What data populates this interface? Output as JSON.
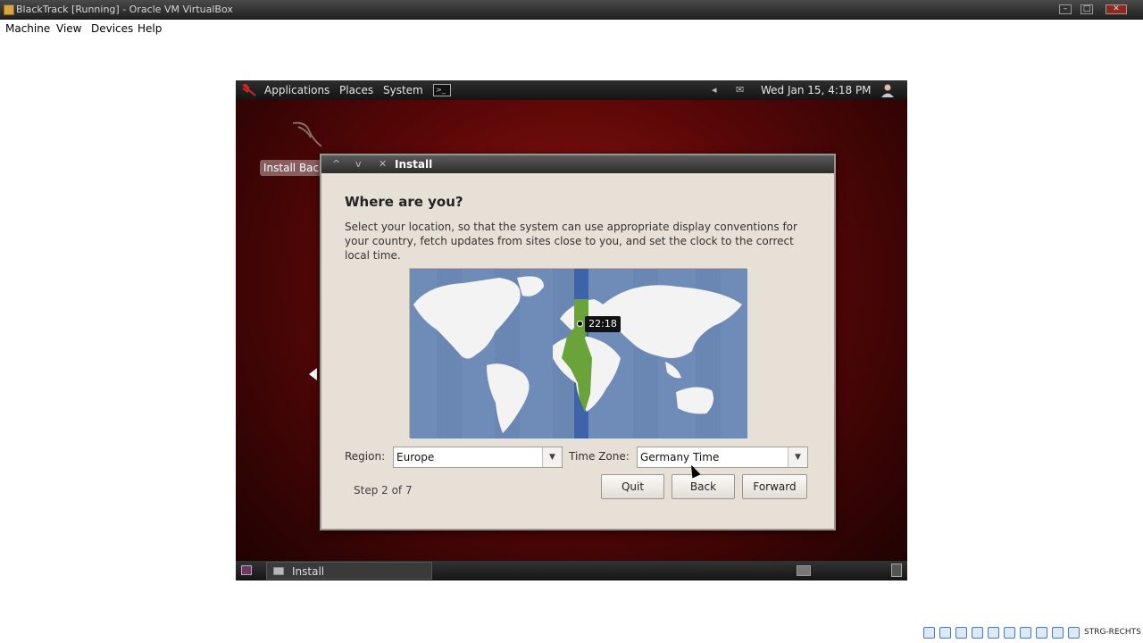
{
  "host": {
    "window_title": "BlackTrack [Running] - Oracle VM VirtualBox",
    "menu": [
      "Machine",
      "View",
      "Devices",
      "Help"
    ],
    "window_controls": [
      "–",
      "□",
      "✕"
    ],
    "status_key": "STRG-RECHTS"
  },
  "guest": {
    "topbar": {
      "menus": [
        "Applications",
        "Places",
        "System"
      ],
      "clock": "Wed Jan 15,  4:18 PM"
    },
    "desktop_icon_label": "Install BackTrack",
    "taskbar": {
      "task_label": "Install"
    }
  },
  "dialog": {
    "title": "Install",
    "title_controls": [
      "^",
      "v",
      "✕"
    ],
    "heading": "Where are you?",
    "description": "Select your location, so that the system can use appropriate display conventions for your country, fetch updates from sites close to you, and set the clock to the correct local time.",
    "map_time": "22:18",
    "region_label": "Region:",
    "region_value": "Europe",
    "timezone_label": "Time Zone:",
    "timezone_value": "Germany Time",
    "step": "Step 2 of 7",
    "buttons": {
      "quit": "Quit",
      "back": "Back",
      "forward": "Forward"
    }
  },
  "colors": {
    "map_ocean": "#6f8cb8",
    "timezone_highlight": "#3f63a8",
    "selected_region": "#6aa33a",
    "wallpaper": "#9a1414"
  }
}
